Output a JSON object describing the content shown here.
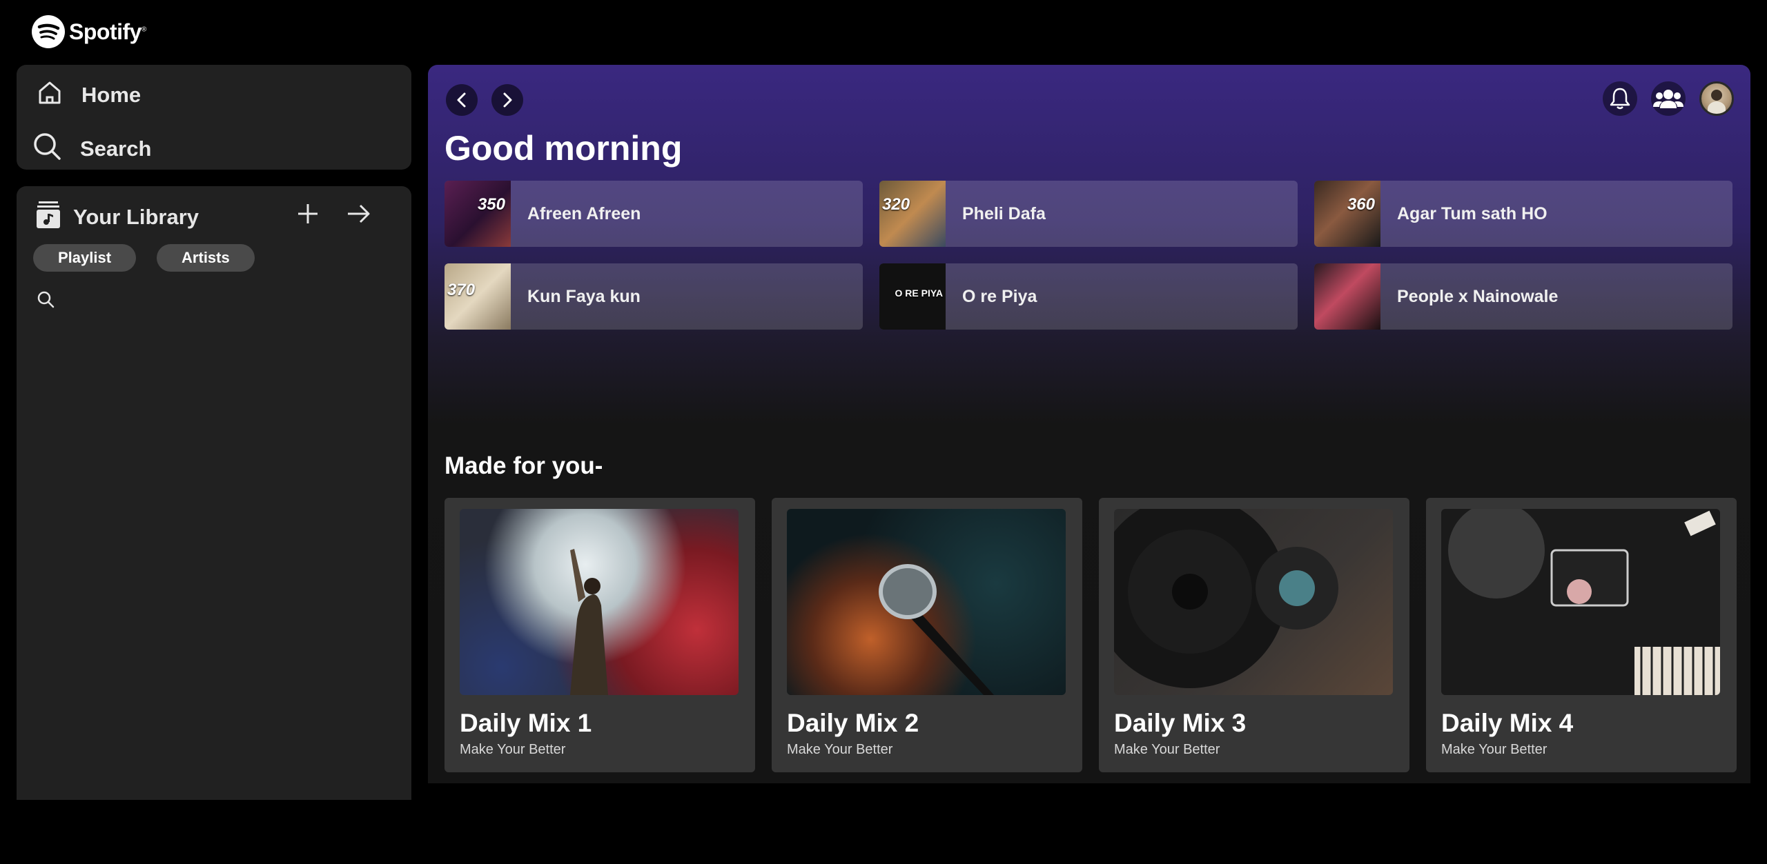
{
  "brand": {
    "name": "Spotify",
    "mark": "®"
  },
  "nav": {
    "home": "Home",
    "search": "Search"
  },
  "library": {
    "title": "Your Library",
    "chips": [
      "Playlist",
      "Artists"
    ]
  },
  "main": {
    "greeting": "Good morning",
    "quick_picks": [
      {
        "title": "Afreen Afreen",
        "badge": "350"
      },
      {
        "title": "Pheli Dafa",
        "badge": "320"
      },
      {
        "title": "Agar Tum sath HO",
        "badge": "360"
      },
      {
        "title": "Kun Faya kun",
        "badge": "370"
      },
      {
        "title": "O re Piya",
        "badge": "O RE PIYA"
      },
      {
        "title": "People x Nainowale",
        "badge": ""
      }
    ],
    "section_title": "Made for you-",
    "mixes": [
      {
        "title": "Daily Mix 1",
        "subtitle": "Make Your Better"
      },
      {
        "title": "Daily Mix 2",
        "subtitle": "Make Your Better"
      },
      {
        "title": "Daily Mix 3",
        "subtitle": "Make Your Better"
      },
      {
        "title": "Daily Mix 4",
        "subtitle": "Make Your Better"
      }
    ]
  },
  "colors": {
    "accent_gradient_top": "#3a2880",
    "panel": "#212121",
    "card": "#363636"
  }
}
